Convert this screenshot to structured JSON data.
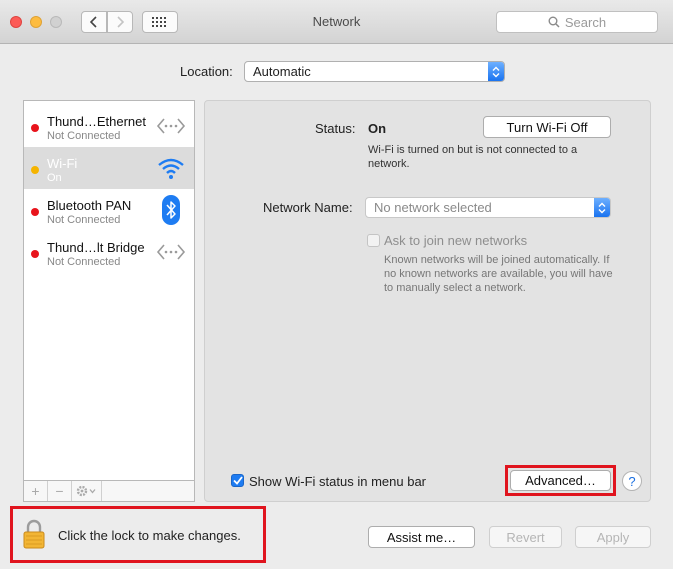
{
  "window": {
    "title": "Network",
    "search_placeholder": "Search"
  },
  "location": {
    "label": "Location:",
    "value": "Automatic"
  },
  "services": [
    {
      "name": "Thund…Ethernet",
      "status": "Not Connected",
      "dot": "#e8141c",
      "icon": "ethernet-arrows-icon"
    },
    {
      "name": "Wi-Fi",
      "status": "On",
      "dot": "#f5b400",
      "icon": "wifi-icon"
    },
    {
      "name": "Bluetooth PAN",
      "status": "Not Connected",
      "dot": "#e8141c",
      "icon": "bluetooth-icon"
    },
    {
      "name": "Thund…lt Bridge",
      "status": "Not Connected",
      "dot": "#e8141c",
      "icon": "ethernet-arrows-icon"
    }
  ],
  "sidebar_controls": {
    "add": "+",
    "remove": "−"
  },
  "detail": {
    "status_label": "Status:",
    "status_value": "On",
    "turn_off_label": "Turn Wi-Fi Off",
    "status_desc": "Wi-Fi is turned on but is not connected to a network.",
    "network_name_label": "Network Name:",
    "network_name_value": "No network selected",
    "ask_join_label": "Ask to join new networks",
    "ask_join_desc": "Known networks will be joined automatically. If no known networks are available, you will have to manually select a network.",
    "show_status_label": "Show Wi-Fi status in menu bar",
    "advanced_label": "Advanced…",
    "help_label": "?"
  },
  "footer": {
    "lock_text": "Click the lock to make changes.",
    "assist_label": "Assist me…",
    "revert_label": "Revert",
    "apply_label": "Apply"
  },
  "colors": {
    "accent": "#1e7cf2",
    "highlight": "#e0141e"
  }
}
